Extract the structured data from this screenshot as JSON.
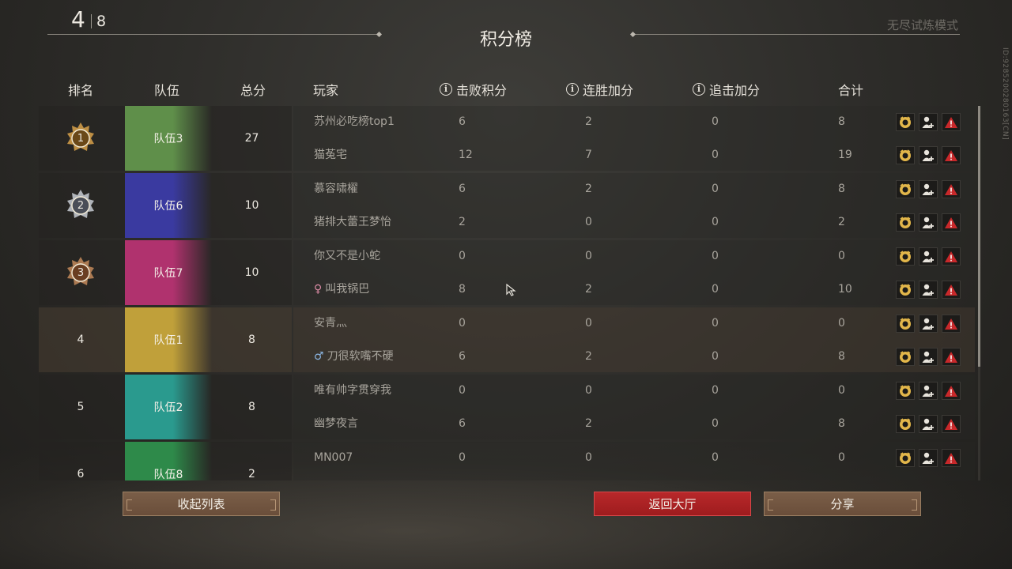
{
  "header": {
    "round_current": "4",
    "round_total": "8",
    "title": "积分榜",
    "mode": "无尽试炼模式",
    "side_id": "ID:9285200280163[CN]"
  },
  "columns": {
    "rank": "排名",
    "team": "队伍",
    "total_score": "总分",
    "player": "玩家",
    "kill_points": "击败积分",
    "streak_bonus": "连胜加分",
    "chase_bonus": "追击加分",
    "sum": "合计"
  },
  "teams": [
    {
      "rank": "1",
      "name": "队伍3",
      "score": "27",
      "color": "#5f8f4a",
      "self": false,
      "players": [
        {
          "name": "苏州必吃榜top1",
          "gender": "",
          "kill": "6",
          "streak": "2",
          "chase": "0",
          "total": "8"
        },
        {
          "name": "猫菟宅",
          "gender": "",
          "kill": "12",
          "streak": "7",
          "chase": "0",
          "total": "19"
        }
      ]
    },
    {
      "rank": "2",
      "name": "队伍6",
      "score": "10",
      "color": "#3a3aa0",
      "self": false,
      "players": [
        {
          "name": "慕容啸櫂",
          "gender": "",
          "kill": "6",
          "streak": "2",
          "chase": "0",
          "total": "8"
        },
        {
          "name": "猪排大蕾王梦怡",
          "gender": "",
          "kill": "2",
          "streak": "0",
          "chase": "0",
          "total": "2"
        }
      ]
    },
    {
      "rank": "3",
      "name": "队伍7",
      "score": "10",
      "color": "#b0326e",
      "self": false,
      "players": [
        {
          "name": "你又不是小蛇",
          "gender": "",
          "kill": "0",
          "streak": "0",
          "chase": "0",
          "total": "0"
        },
        {
          "name": "叫我锅巴",
          "gender": "♀",
          "kill": "8",
          "streak": "2",
          "chase": "0",
          "total": "10"
        }
      ]
    },
    {
      "rank": "4",
      "name": "队伍1",
      "score": "8",
      "color": "#c0a03a",
      "self": true,
      "players": [
        {
          "name": "安青灬",
          "gender": "",
          "kill": "0",
          "streak": "0",
          "chase": "0",
          "total": "0"
        },
        {
          "name": "刀很软嘴不硬",
          "gender": "♂",
          "kill": "6",
          "streak": "2",
          "chase": "0",
          "total": "8"
        }
      ]
    },
    {
      "rank": "5",
      "name": "队伍2",
      "score": "8",
      "color": "#2a9a8e",
      "self": false,
      "players": [
        {
          "name": "唯有帅字贯穿我",
          "gender": "",
          "kill": "0",
          "streak": "0",
          "chase": "0",
          "total": "0"
        },
        {
          "name": "幽梦夜言",
          "gender": "",
          "kill": "6",
          "streak": "2",
          "chase": "0",
          "total": "8"
        }
      ]
    },
    {
      "rank": "6",
      "name": "队伍8",
      "score": "2",
      "color": "#2e8a4a",
      "self": false,
      "players": [
        {
          "name": "MN007",
          "gender": "",
          "kill": "0",
          "streak": "0",
          "chase": "0",
          "total": "0"
        }
      ]
    }
  ],
  "buttons": {
    "collapse": "收起列表",
    "lobby": "返回大厅",
    "share": "分享"
  },
  "row_action_icons": [
    "profile-icon",
    "add-friend-icon",
    "report-icon"
  ],
  "colors": {
    "lobby_button": "#b8282a",
    "button_brown": "#7a5e48",
    "gold_badge": "#d9a24a",
    "silver_badge": "#c8ccd4",
    "bronze_badge": "#c48a5a",
    "report_red": "#c8282a"
  }
}
